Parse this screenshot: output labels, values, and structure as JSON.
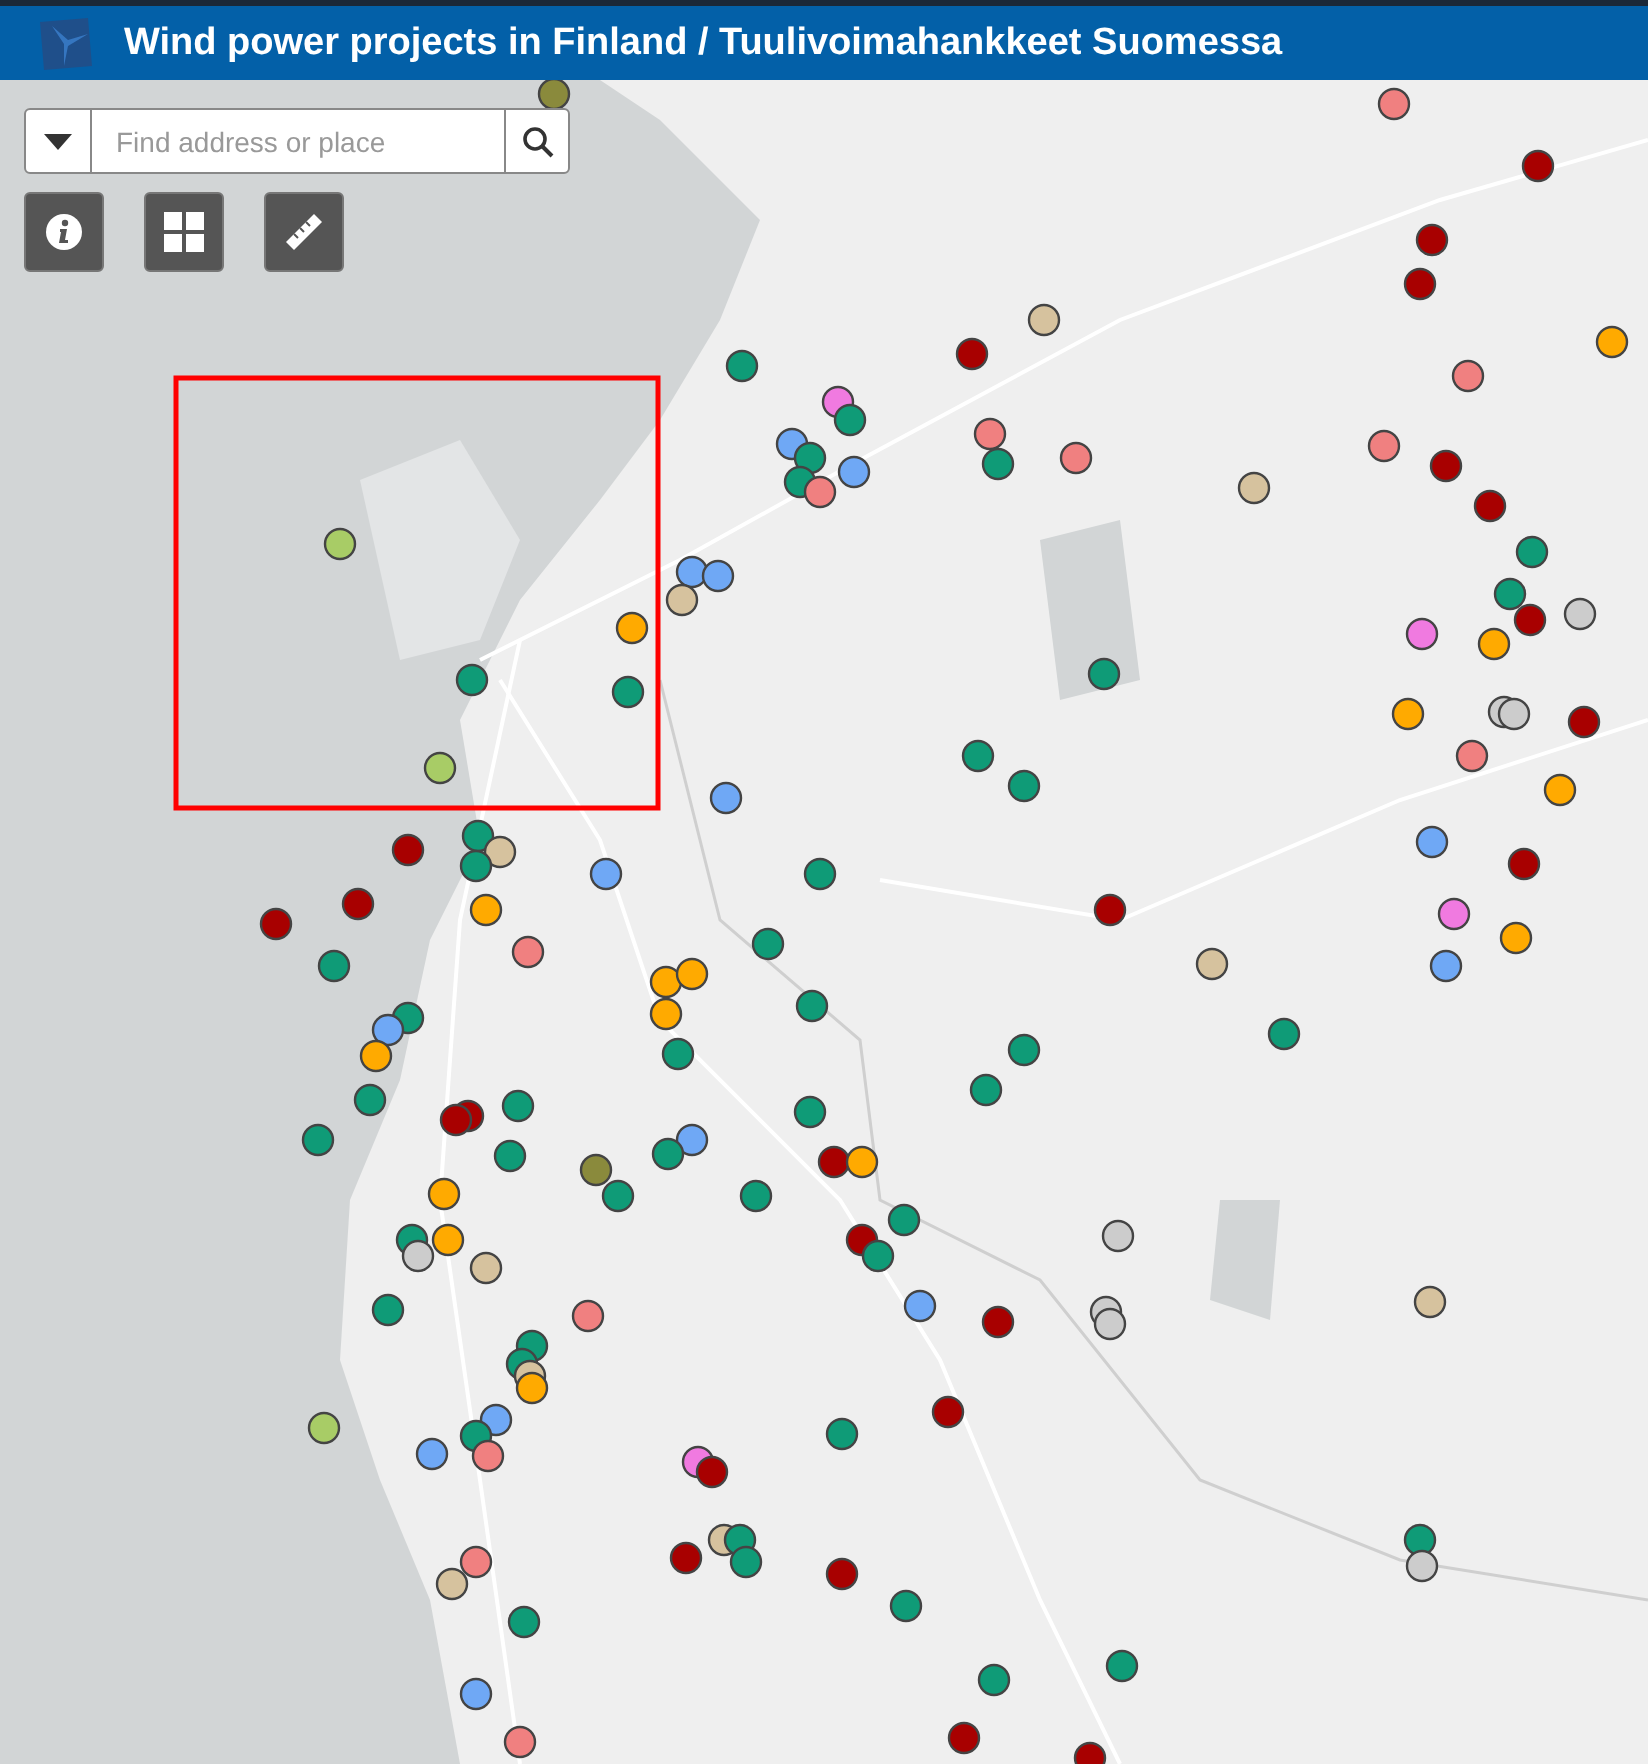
{
  "header": {
    "title": "Wind power projects in Finland / Tuulivoimahankkeet Suomessa"
  },
  "search": {
    "placeholder": "Find address or place"
  },
  "map": {
    "markers": [
      {
        "color": "#8a8a3c"
      },
      {
        "color": "#f08080"
      },
      {
        "color": "#a80000"
      },
      {
        "color": "#a80000"
      },
      {
        "color": "#a80000"
      },
      {
        "color": "#d6c29e"
      },
      {
        "color": "#a80000"
      },
      {
        "color": "#ffaa00"
      },
      {
        "color": "#0f9b77"
      },
      {
        "color": "#f08080"
      },
      {
        "color": "#f07ae0"
      },
      {
        "color": "#0f9b77"
      },
      {
        "color": "#6fa8f5"
      },
      {
        "color": "#0f9b77"
      },
      {
        "color": "#f08080"
      },
      {
        "color": "#f08080"
      },
      {
        "color": "#f08080"
      },
      {
        "color": "#a80000"
      },
      {
        "color": "#6fa8f5"
      },
      {
        "color": "#0f9b77"
      },
      {
        "color": "#f08080"
      },
      {
        "color": "#0f9b77"
      },
      {
        "color": "#d6c29e"
      },
      {
        "color": "#a80000"
      },
      {
        "color": "#0f9b77"
      },
      {
        "color": "#a8cc66"
      },
      {
        "color": "#6fa8f5"
      },
      {
        "color": "#6fa8f5"
      },
      {
        "color": "#d6c29e"
      },
      {
        "color": "#0f9b77"
      },
      {
        "color": "#cccccc"
      },
      {
        "color": "#a80000"
      },
      {
        "color": "#f07ae0"
      },
      {
        "color": "#ffaa00"
      },
      {
        "color": "#ffaa00"
      },
      {
        "color": "#0f9b77"
      },
      {
        "color": "#0f9b77"
      },
      {
        "color": "#0f9b77"
      },
      {
        "color": "#ffaa00"
      },
      {
        "color": "#cccccc"
      },
      {
        "color": "#cccccc"
      },
      {
        "color": "#a80000"
      },
      {
        "color": "#0f9b77"
      },
      {
        "color": "#f08080"
      },
      {
        "color": "#a8cc66"
      },
      {
        "color": "#0f9b77"
      },
      {
        "color": "#ffaa00"
      },
      {
        "color": "#6fa8f5"
      },
      {
        "color": "#0f9b77"
      },
      {
        "color": "#6fa8f5"
      },
      {
        "color": "#a80000"
      },
      {
        "color": "#d6c29e"
      },
      {
        "color": "#0f9b77"
      },
      {
        "color": "#6fa8f5"
      },
      {
        "color": "#0f9b77"
      },
      {
        "color": "#a80000"
      },
      {
        "color": "#a80000"
      },
      {
        "color": "#a80000"
      },
      {
        "color": "#a80000"
      },
      {
        "color": "#ffaa00"
      },
      {
        "color": "#f07ae0"
      },
      {
        "color": "#ffaa00"
      },
      {
        "color": "#f08080"
      },
      {
        "color": "#0f9b77"
      },
      {
        "color": "#0f9b77"
      },
      {
        "color": "#ffaa00"
      },
      {
        "color": "#ffaa00"
      },
      {
        "color": "#d6c29e"
      },
      {
        "color": "#6fa8f5"
      },
      {
        "color": "#0f9b77"
      },
      {
        "color": "#0f9b77"
      },
      {
        "color": "#6fa8f5"
      },
      {
        "color": "#ffaa00"
      },
      {
        "color": "#ffaa00"
      },
      {
        "color": "#0f9b77"
      },
      {
        "color": "#0f9b77"
      },
      {
        "color": "#0f9b77"
      },
      {
        "color": "#0f9b77"
      },
      {
        "color": "#0f9b77"
      },
      {
        "color": "#0f9b77"
      },
      {
        "color": "#a80000"
      },
      {
        "color": "#a80000"
      },
      {
        "color": "#0f9b77"
      },
      {
        "color": "#0f9b77"
      },
      {
        "color": "#0f9b77"
      },
      {
        "color": "#6fa8f5"
      },
      {
        "color": "#0f9b77"
      },
      {
        "color": "#8a8a3c"
      },
      {
        "color": "#a80000"
      },
      {
        "color": "#ffaa00"
      },
      {
        "color": "#0f9b77"
      },
      {
        "color": "#0f9b77"
      },
      {
        "color": "#ffaa00"
      },
      {
        "color": "#0f9b77"
      },
      {
        "color": "#0f9b77"
      },
      {
        "color": "#ffaa00"
      },
      {
        "color": "#cccccc"
      },
      {
        "color": "#a80000"
      },
      {
        "color": "#0f9b77"
      },
      {
        "color": "#cccccc"
      },
      {
        "color": "#d6c29e"
      },
      {
        "color": "#6fa8f5"
      },
      {
        "color": "#f08080"
      },
      {
        "color": "#0f9b77"
      },
      {
        "color": "#a80000"
      },
      {
        "color": "#cccccc"
      },
      {
        "color": "#cccccc"
      },
      {
        "color": "#d6c29e"
      },
      {
        "color": "#0f9b77"
      },
      {
        "color": "#0f9b77"
      },
      {
        "color": "#d6c29e"
      },
      {
        "color": "#ffaa00"
      },
      {
        "color": "#a8cc66"
      },
      {
        "color": "#a80000"
      },
      {
        "color": "#6fa8f5"
      },
      {
        "color": "#0f9b77"
      },
      {
        "color": "#6fa8f5"
      },
      {
        "color": "#0f9b77"
      },
      {
        "color": "#f08080"
      },
      {
        "color": "#f07ae0"
      },
      {
        "color": "#a80000"
      },
      {
        "color": "#f08080"
      },
      {
        "color": "#d6c29e"
      },
      {
        "color": "#d6c29e"
      },
      {
        "color": "#0f9b77"
      },
      {
        "color": "#0f9b77"
      },
      {
        "color": "#a80000"
      },
      {
        "color": "#a80000"
      },
      {
        "color": "#0f9b77"
      },
      {
        "color": "#0f9b77"
      },
      {
        "color": "#0f9b77"
      },
      {
        "color": "#cccccc"
      },
      {
        "color": "#6fa8f5"
      },
      {
        "color": "#0f9b77"
      },
      {
        "color": "#0f9b77"
      },
      {
        "color": "#f08080"
      },
      {
        "color": "#a80000"
      },
      {
        "color": "#a80000"
      }
    ]
  }
}
